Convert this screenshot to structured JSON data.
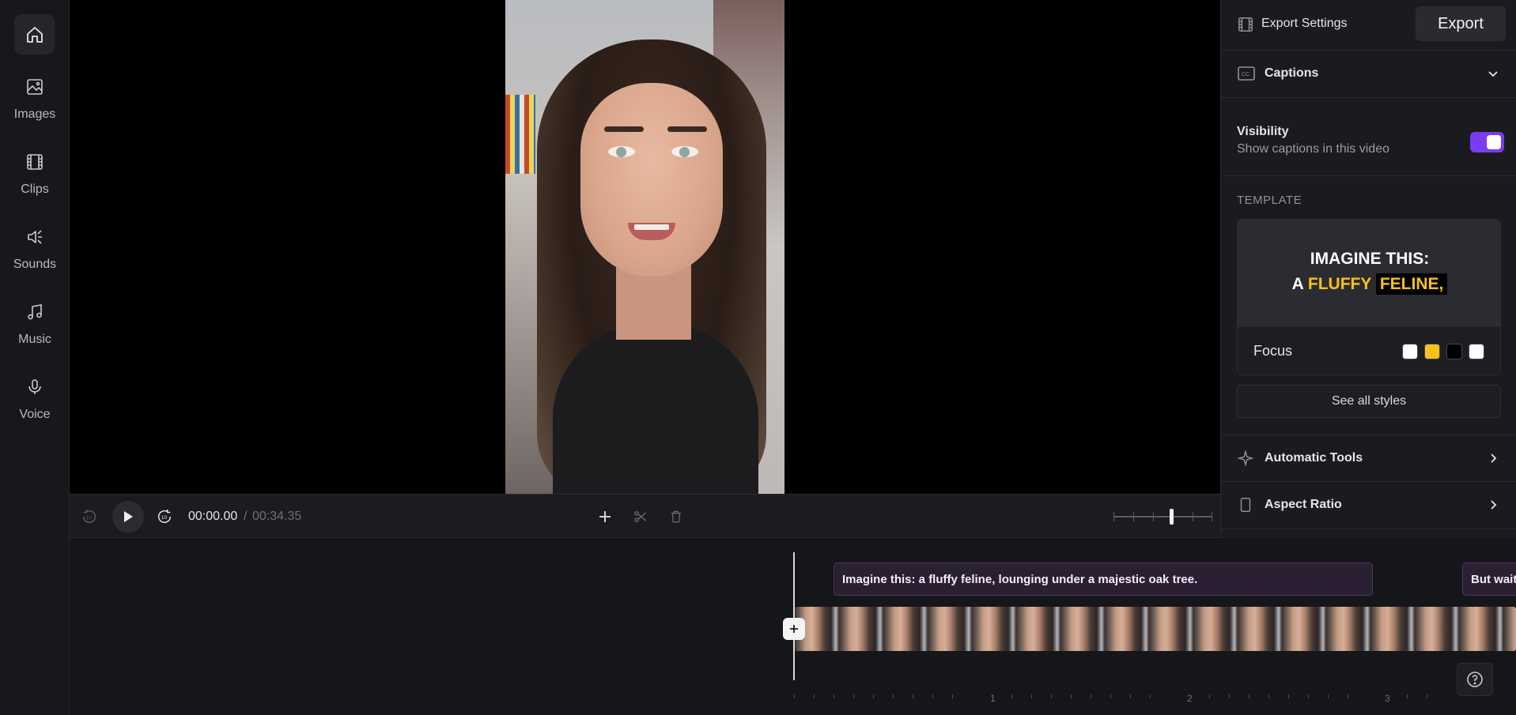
{
  "rail": {
    "home_icon": "home-icon",
    "items": [
      {
        "label": "Images",
        "icon": "images-icon"
      },
      {
        "label": "Clips",
        "icon": "film-icon"
      },
      {
        "label": "Sounds",
        "icon": "sound-icon"
      },
      {
        "label": "Music",
        "icon": "music-note-icon"
      },
      {
        "label": "Voice",
        "icon": "microphone-icon"
      }
    ]
  },
  "player": {
    "current_time": "00:00.00",
    "separator": "/",
    "total_time": "00:34.35",
    "rewind_label": "10",
    "forward_label": "10",
    "zoom_level": 0.55
  },
  "panel": {
    "header_title": "Export Settings",
    "export_label": "Export",
    "captions_label": "Captions",
    "visibility_title": "Visibility",
    "visibility_subtitle": "Show captions in this video",
    "visibility_on": true,
    "template_label": "TEMPLATE",
    "template": {
      "line1": "IMAGINE THIS:",
      "line2_a": "A",
      "line2_b": "FLUFFY",
      "line2_c": "FELINE,",
      "name": "Focus",
      "swatches": [
        "#ffffff",
        "#f8c21a",
        "#000000",
        "#ffffff"
      ]
    },
    "see_all_label": "See all styles",
    "automatic_tools_label": "Automatic Tools",
    "aspect_ratio_label": "Aspect Ratio"
  },
  "timeline": {
    "captions": [
      "Imagine this: a fluffy feline, lounging under a majestic oak tree.",
      "But wait"
    ],
    "ruler_numbers": [
      "1",
      "2",
      "3"
    ]
  },
  "colors": {
    "accent": "#7b3cf0",
    "caption_yellow": "#f8c21a",
    "background": "#15161a"
  }
}
